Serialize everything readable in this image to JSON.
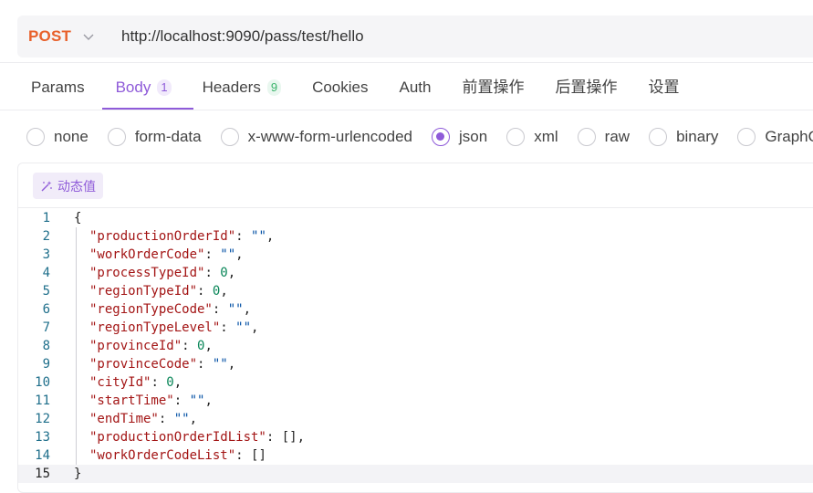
{
  "request": {
    "method": "POST",
    "url": "http://localhost:9090/pass/test/hello"
  },
  "tabs": [
    {
      "label": "Params",
      "badge": "",
      "active": false
    },
    {
      "label": "Body",
      "badge": "1",
      "active": true
    },
    {
      "label": "Headers",
      "badge": "9",
      "active": false
    },
    {
      "label": "Cookies",
      "badge": "",
      "active": false
    },
    {
      "label": "Auth",
      "badge": "",
      "active": false
    },
    {
      "label": "前置操作",
      "badge": "",
      "active": false
    },
    {
      "label": "后置操作",
      "badge": "",
      "active": false
    },
    {
      "label": "设置",
      "badge": "",
      "active": false
    }
  ],
  "body_types": [
    {
      "label": "none",
      "selected": false
    },
    {
      "label": "form-data",
      "selected": false
    },
    {
      "label": "x-www-form-urlencoded",
      "selected": false
    },
    {
      "label": "json",
      "selected": true
    },
    {
      "label": "xml",
      "selected": false
    },
    {
      "label": "raw",
      "selected": false
    },
    {
      "label": "binary",
      "selected": false
    },
    {
      "label": "GraphQL",
      "selected": false
    }
  ],
  "editor": {
    "dynamic_value_label": "动态值",
    "current_line": 15,
    "open_brace": "{",
    "close_brace": "}",
    "fields": [
      {
        "key": "productionOrderId",
        "value": "\"\"",
        "type": "string"
      },
      {
        "key": "workOrderCode",
        "value": "\"\"",
        "type": "string"
      },
      {
        "key": "processTypeId",
        "value": "0",
        "type": "number"
      },
      {
        "key": "regionTypeId",
        "value": "0",
        "type": "number"
      },
      {
        "key": "regionTypeCode",
        "value": "\"\"",
        "type": "string"
      },
      {
        "key": "regionTypeLevel",
        "value": "\"\"",
        "type": "string"
      },
      {
        "key": "provinceId",
        "value": "0",
        "type": "number"
      },
      {
        "key": "provinceCode",
        "value": "\"\"",
        "type": "string"
      },
      {
        "key": "cityId",
        "value": "0",
        "type": "number"
      },
      {
        "key": "startTime",
        "value": "\"\"",
        "type": "string"
      },
      {
        "key": "endTime",
        "value": "\"\"",
        "type": "string"
      },
      {
        "key": "productionOrderIdList",
        "value": "[]",
        "type": "array"
      },
      {
        "key": "workOrderCodeList",
        "value": "[]",
        "type": "array"
      }
    ]
  },
  "colors": {
    "method": "#e8612c",
    "accent": "#8f5bd9",
    "badge_green": "#3bb36b",
    "json_key": "#a31515",
    "json_string": "#0451a5",
    "json_number": "#098658"
  }
}
